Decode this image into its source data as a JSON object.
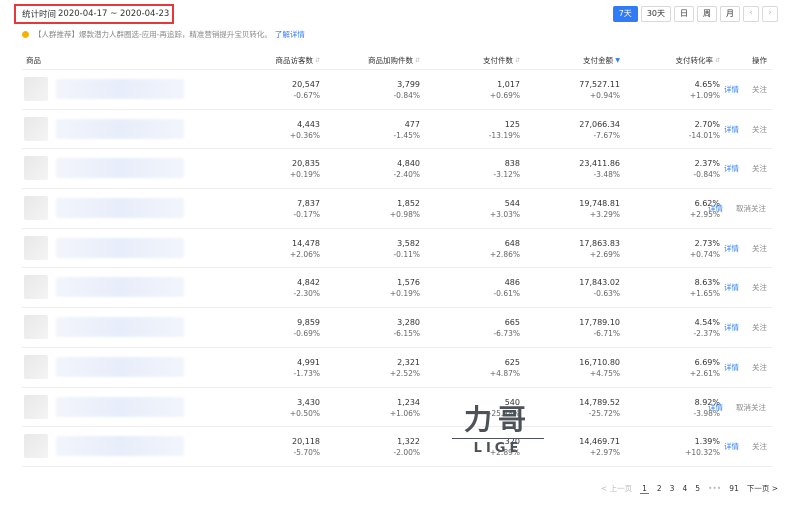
{
  "header": {
    "stat_label": "统计时间",
    "stat_range": "2020-04-17 ~ 2020-04-23",
    "ranges": [
      "7天",
      "30天",
      "日",
      "周",
      "月"
    ],
    "active_range": "7天",
    "prev_icon": "chevron-left-icon",
    "next_icon": "chevron-right-icon"
  },
  "tip": {
    "text": "【人群推荐】爆款潜力人群圈选-应用-再追踪，精准营销提升宝贝转化。",
    "link": "了解详情"
  },
  "table": {
    "columns": [
      "商品",
      "商品访客数",
      "商品加购件数",
      "支付件数",
      "支付金额",
      "支付转化率",
      "操作"
    ],
    "sorted_column": "支付金额",
    "rows": [
      {
        "visitors": "20,547",
        "visitors_chg": "-0.67%",
        "cart": "3,799",
        "cart_chg": "-0.84%",
        "pay_items": "1,017",
        "pay_items_chg": "+0.69%",
        "amount": "77,527.11",
        "amount_chg": "+0.94%",
        "conv": "4.65%",
        "conv_chg": "+1.09%",
        "detail": "详情",
        "follow": "关注"
      },
      {
        "visitors": "4,443",
        "visitors_chg": "+0.36%",
        "cart": "477",
        "cart_chg": "-1.45%",
        "pay_items": "125",
        "pay_items_chg": "-13.19%",
        "amount": "27,066.34",
        "amount_chg": "-7.67%",
        "conv": "2.70%",
        "conv_chg": "-14.01%",
        "detail": "详情",
        "follow": "关注"
      },
      {
        "visitors": "20,835",
        "visitors_chg": "+0.19%",
        "cart": "4,840",
        "cart_chg": "-2.40%",
        "pay_items": "838",
        "pay_items_chg": "-3.12%",
        "amount": "23,411.86",
        "amount_chg": "-3.48%",
        "conv": "2.37%",
        "conv_chg": "-0.84%",
        "detail": "详情",
        "follow": "关注"
      },
      {
        "visitors": "7,837",
        "visitors_chg": "-0.17%",
        "cart": "1,852",
        "cart_chg": "+0.98%",
        "pay_items": "544",
        "pay_items_chg": "+3.03%",
        "amount": "19,748.81",
        "amount_chg": "+3.29%",
        "conv": "6.62%",
        "conv_chg": "+2.95%",
        "detail": "详情",
        "follow": "取消关注"
      },
      {
        "visitors": "14,478",
        "visitors_chg": "+2.06%",
        "cart": "3,582",
        "cart_chg": "-0.11%",
        "pay_items": "648",
        "pay_items_chg": "+2.86%",
        "amount": "17,863.83",
        "amount_chg": "+2.69%",
        "conv": "2.73%",
        "conv_chg": "+0.74%",
        "detail": "详情",
        "follow": "关注"
      },
      {
        "visitors": "4,842",
        "visitors_chg": "-2.30%",
        "cart": "1,576",
        "cart_chg": "+0.19%",
        "pay_items": "486",
        "pay_items_chg": "-0.61%",
        "amount": "17,843.02",
        "amount_chg": "-0.63%",
        "conv": "8.63%",
        "conv_chg": "+1.65%",
        "detail": "详情",
        "follow": "关注"
      },
      {
        "visitors": "9,859",
        "visitors_chg": "-0.69%",
        "cart": "3,280",
        "cart_chg": "-6.15%",
        "pay_items": "665",
        "pay_items_chg": "-6.73%",
        "amount": "17,789.10",
        "amount_chg": "-6.71%",
        "conv": "4.54%",
        "conv_chg": "-2.37%",
        "detail": "详情",
        "follow": "关注"
      },
      {
        "visitors": "4,991",
        "visitors_chg": "-1.73%",
        "cart": "2,321",
        "cart_chg": "+2.52%",
        "pay_items": "625",
        "pay_items_chg": "+4.87%",
        "amount": "16,710.80",
        "amount_chg": "+4.75%",
        "conv": "6.69%",
        "conv_chg": "+2.61%",
        "detail": "详情",
        "follow": "关注"
      },
      {
        "visitors": "3,430",
        "visitors_chg": "+0.50%",
        "cart": "1,234",
        "cart_chg": "+1.06%",
        "pay_items": "540",
        "pay_items_chg": "-25.48%",
        "amount": "14,789.52",
        "amount_chg": "-25.72%",
        "conv": "8.92%",
        "conv_chg": "-3.98%",
        "detail": "详情",
        "follow": "取消关注"
      },
      {
        "visitors": "20,118",
        "visitors_chg": "-5.70%",
        "cart": "1,322",
        "cart_chg": "-2.00%",
        "pay_items": "320",
        "pay_items_chg": "+2.89%",
        "amount": "14,469.71",
        "amount_chg": "+2.97%",
        "conv": "1.39%",
        "conv_chg": "+10.32%",
        "detail": "详情",
        "follow": "关注"
      }
    ]
  },
  "pager": {
    "prev": "< 上一页",
    "pages": [
      "1",
      "2",
      "3",
      "4",
      "5"
    ],
    "current": "1",
    "ellipsis": "•••",
    "last": "91",
    "next": "下一页 >"
  },
  "watermark": {
    "big": "力哥",
    "small": "LIGE"
  }
}
